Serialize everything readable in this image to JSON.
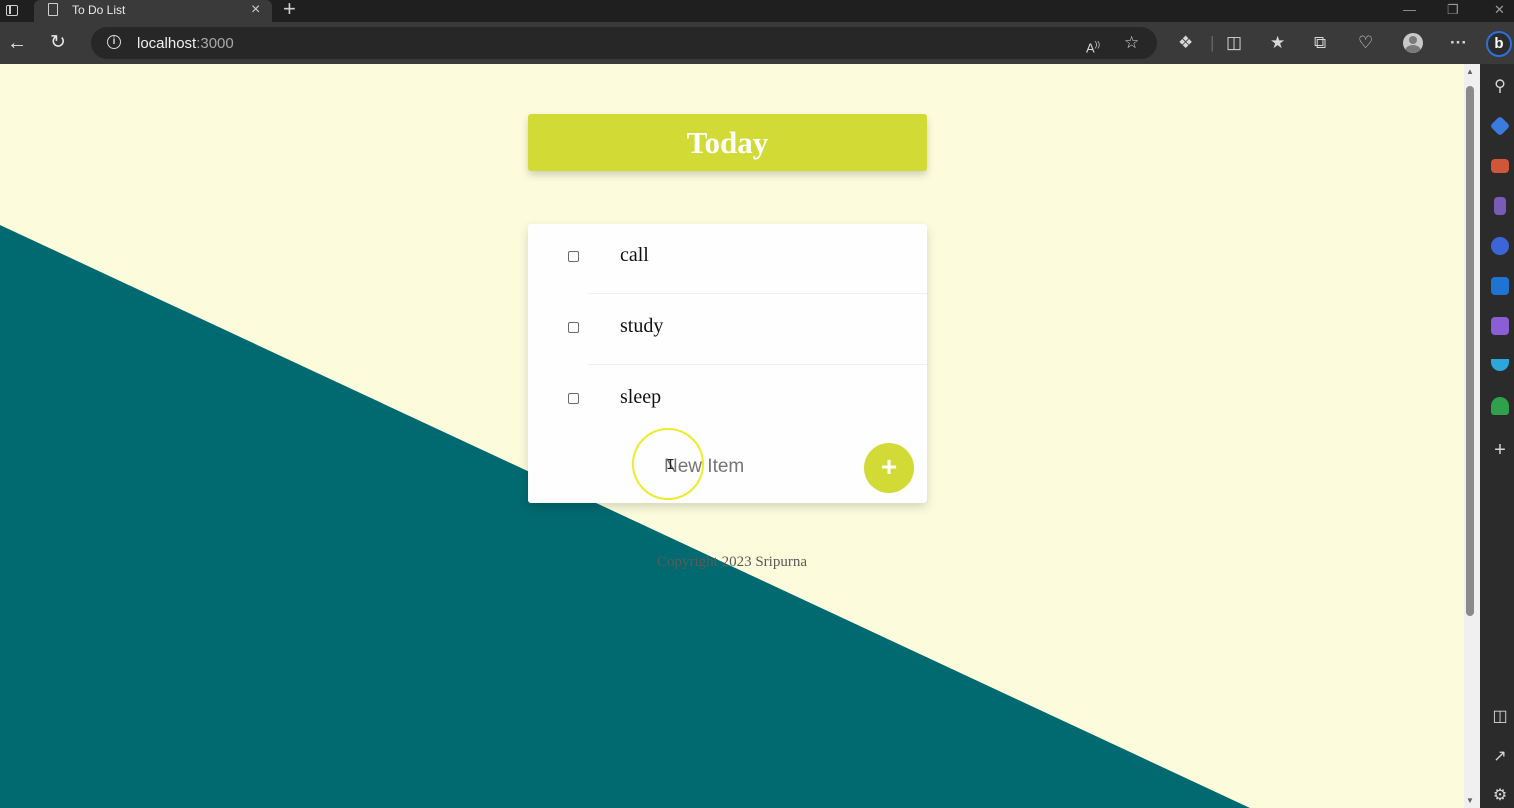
{
  "browser": {
    "tab_title": "To Do List",
    "tab_close": "×",
    "new_tab": "+",
    "url_host": "localhost",
    "url_port": ":3000",
    "read_aloud_label": "A",
    "window_min": "—",
    "window_max": "❐",
    "window_close": "✕"
  },
  "page": {
    "heading": "Today",
    "items": [
      {
        "label": "call",
        "checked": false
      },
      {
        "label": "study",
        "checked": false
      },
      {
        "label": "sleep",
        "checked": false
      }
    ],
    "new_item_placeholder": "New Item",
    "add_button_label": "+",
    "footer": "Copyright 2023 Sripurna",
    "colors": {
      "background": "#fcfcdd",
      "diagonal": "#006a70",
      "accent": "#d2db36"
    }
  },
  "sidebar_icons": [
    "search-icon",
    "tag-icon",
    "toolbox-icon",
    "chess-icon",
    "copilot-icon",
    "outlook-icon",
    "designer-icon",
    "send-icon",
    "tree-icon",
    "add-icon",
    "split-screen-icon",
    "external-link-icon",
    "settings-icon"
  ]
}
